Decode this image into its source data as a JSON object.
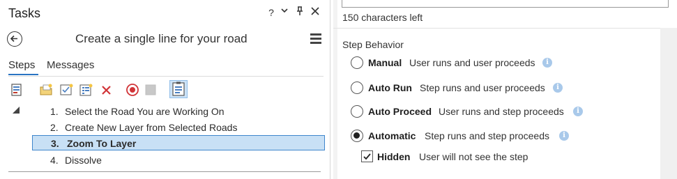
{
  "pane": {
    "title": "Tasks",
    "help_glyph": "?",
    "dropdown_glyph": "⌄",
    "pin_glyph": "📌",
    "close_glyph": "✕"
  },
  "task": {
    "title": "Create a single line for your road"
  },
  "tabs": [
    {
      "label": "Steps",
      "active": true
    },
    {
      "label": "Messages",
      "active": false
    }
  ],
  "toolbar": {
    "icons": [
      "task-item-icon",
      "new-group-icon",
      "new-step-icon",
      "new-task-icon",
      "delete-icon",
      "record-icon",
      "stop-icon",
      "step-properties-icon"
    ],
    "delete_glyph": "✕"
  },
  "steps": [
    {
      "num": "1.",
      "label": "Select the Road You are Working On",
      "selected": false
    },
    {
      "num": "2.",
      "label": "Create New Layer from Selected Roads",
      "selected": false
    },
    {
      "num": "3.",
      "label": "Zoom To Layer",
      "selected": true
    },
    {
      "num": "4.",
      "label": "Dissolve",
      "selected": false
    }
  ],
  "details": {
    "chars_left": "150 characters left",
    "section_title": "Step Behavior",
    "options": [
      {
        "label": "Manual",
        "desc": "User runs and user proceeds",
        "checked": false
      },
      {
        "label": "Auto Run",
        "desc": "Step runs and user proceeds",
        "checked": false
      },
      {
        "label": "Auto Proceed",
        "desc": "User runs and step proceeds",
        "checked": false
      },
      {
        "label": "Automatic",
        "desc": "Step runs and step proceeds",
        "checked": true
      }
    ],
    "hidden": {
      "label": "Hidden",
      "desc": "User will not see the step",
      "checked": true
    }
  },
  "colors": {
    "accent": "#2a74c2",
    "selection_bg": "#c8e0f5",
    "info_icon": "#a9c9ea",
    "delete_red": "#d13438"
  }
}
